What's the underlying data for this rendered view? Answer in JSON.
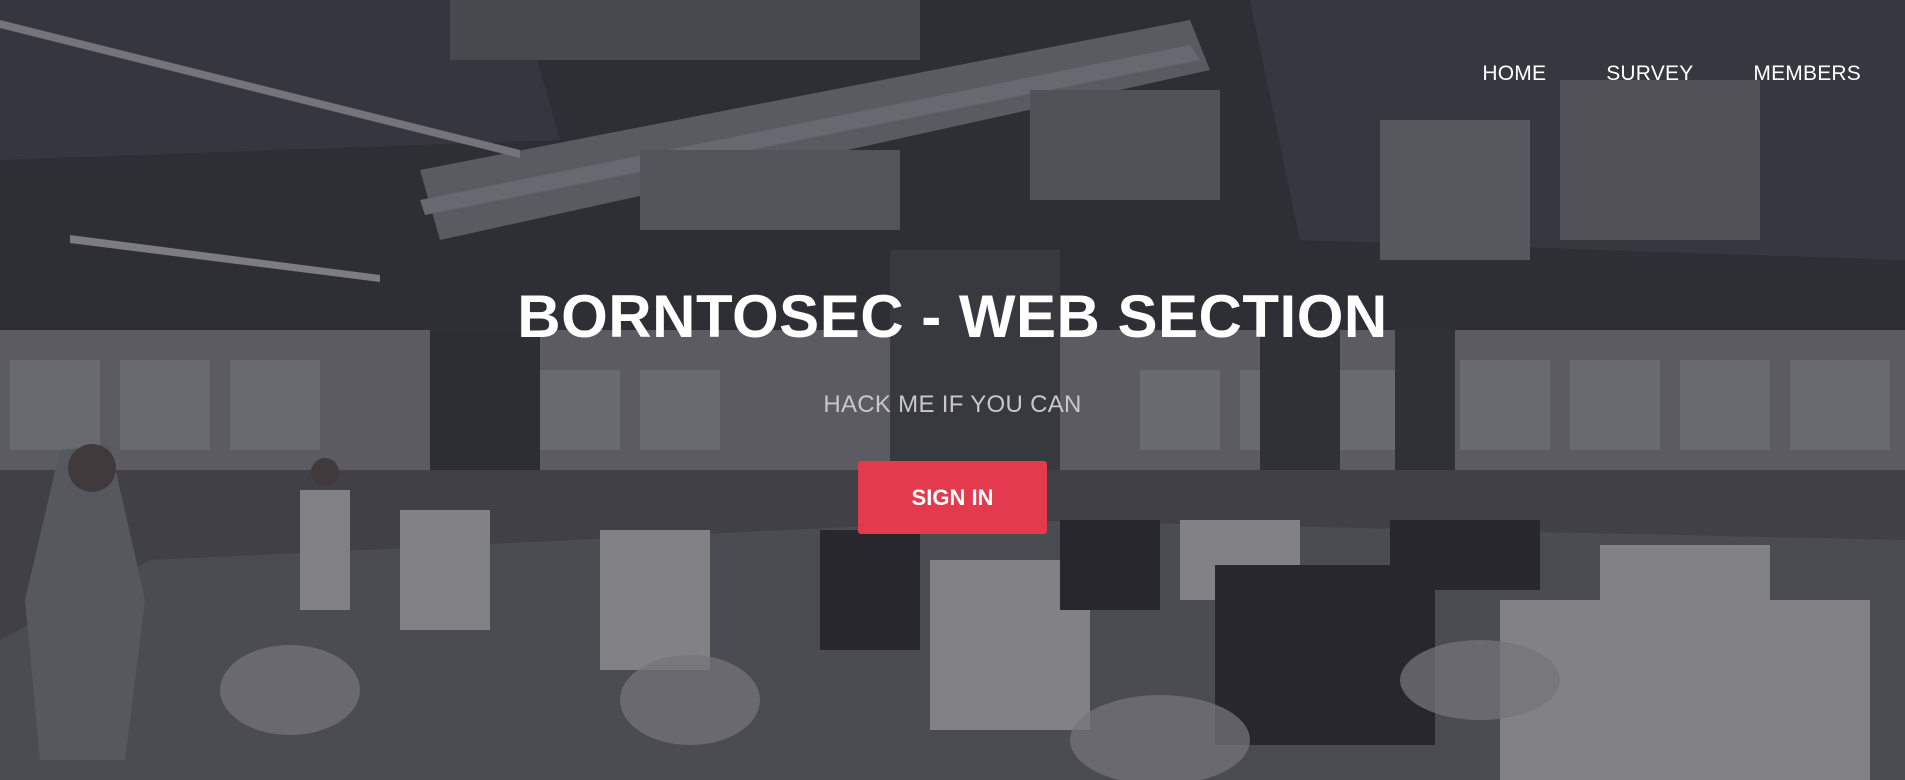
{
  "nav": {
    "items": [
      {
        "label": "HOME"
      },
      {
        "label": "SURVEY"
      },
      {
        "label": "MEMBERS"
      }
    ]
  },
  "hero": {
    "title": "BORNTOSEC - WEB SECTION",
    "subtitle": "HACK ME IF YOU CAN",
    "cta_label": "SIGN IN"
  },
  "colors": {
    "accent": "#e33b4d",
    "text": "#ffffff",
    "subtitle": "#c8c8cc",
    "background_tint": "#2a2a30"
  }
}
